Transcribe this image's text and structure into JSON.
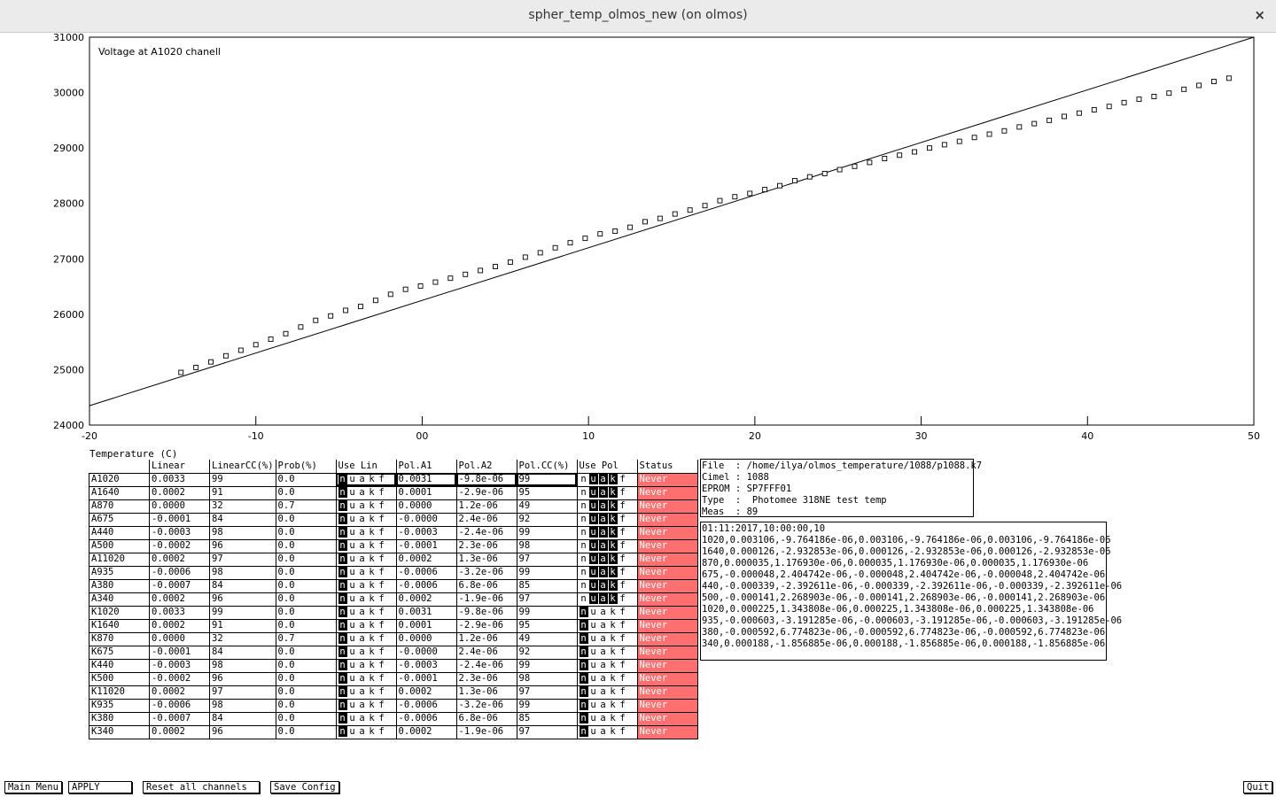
{
  "window": {
    "title": "spher_temp_olmos_new (on olmos)",
    "close_glyph": "×"
  },
  "chart_data": {
    "type": "scatter",
    "title": "Voltage at A1020 chanell",
    "xlabel": "Temperature (C)",
    "ylabel": "",
    "xlim": [
      -20,
      50
    ],
    "ylim": [
      24000,
      31000
    ],
    "x_ticks": [
      "-20",
      "-10",
      "00",
      "10",
      "20",
      "30",
      "40",
      "50"
    ],
    "y_ticks": [
      "24000",
      "25000",
      "26000",
      "27000",
      "28000",
      "29000",
      "30000",
      "31000"
    ],
    "fit_line": {
      "x": [
        -20,
        50
      ],
      "y": [
        24350,
        31000
      ]
    },
    "points": {
      "x": [
        -14.5,
        -13.6,
        -12.7,
        -11.8,
        -10.9,
        -10.0,
        -9.1,
        -8.2,
        -7.3,
        -6.4,
        -5.5,
        -4.6,
        -3.7,
        -2.8,
        -1.9,
        -1.0,
        -0.1,
        0.8,
        1.7,
        2.6,
        3.5,
        4.4,
        5.3,
        6.2,
        7.1,
        8.0,
        8.9,
        9.8,
        10.7,
        11.6,
        12.5,
        13.4,
        14.3,
        15.2,
        16.1,
        17.0,
        17.9,
        18.8,
        19.7,
        20.6,
        21.5,
        22.4,
        23.3,
        24.2,
        25.1,
        26.0,
        26.9,
        27.8,
        28.7,
        29.6,
        30.5,
        31.4,
        32.3,
        33.2,
        34.1,
        35.0,
        35.9,
        36.8,
        37.7,
        38.6,
        39.5,
        40.4,
        41.3,
        42.2,
        43.1,
        44.0,
        44.9,
        45.8,
        46.7,
        47.6,
        48.5
      ],
      "y": [
        24950,
        25040,
        25140,
        25250,
        25350,
        25450,
        25550,
        25650,
        25770,
        25890,
        25970,
        26070,
        26140,
        26250,
        26360,
        26450,
        26510,
        26580,
        26650,
        26720,
        26790,
        26860,
        26940,
        27030,
        27110,
        27200,
        27290,
        27370,
        27450,
        27500,
        27570,
        27670,
        27730,
        27810,
        27880,
        27960,
        28050,
        28120,
        28180,
        28250,
        28320,
        28410,
        28480,
        28540,
        28610,
        28670,
        28740,
        28810,
        28870,
        28930,
        29000,
        29060,
        29120,
        29190,
        29250,
        29310,
        29380,
        29440,
        29500,
        29570,
        29630,
        29690,
        29750,
        29820,
        29880,
        29930,
        29990,
        30060,
        30130,
        30200,
        30260
      ]
    }
  },
  "table": {
    "headers": [
      "",
      "Linear",
      "LinearCC(%)",
      "Prob(%)",
      "Use Lin",
      "Pol.A1",
      "Pol.A2",
      "Pol.CC(%)",
      "Use Pol",
      "Status"
    ],
    "rows": [
      {
        "name": "A1020",
        "lin": "0.0033",
        "lcc": "99",
        "prob": "0.0",
        "a1": "0.0031",
        "a2": "-9.8e-06",
        "pcc": "99",
        "status": "Never",
        "uselin": "n",
        "usepol": "uak"
      },
      {
        "name": "A1640",
        "lin": "0.0002",
        "lcc": "91",
        "prob": "0.0",
        "a1": "0.0001",
        "a2": "-2.9e-06",
        "pcc": "95",
        "status": "Never",
        "uselin": "n",
        "usepol": "uak"
      },
      {
        "name": "A870",
        "lin": "0.0000",
        "lcc": "32",
        "prob": "0.7",
        "a1": "0.0000",
        "a2": "1.2e-06",
        "pcc": "49",
        "status": "Never",
        "uselin": "n",
        "usepol": "uak"
      },
      {
        "name": "A675",
        "lin": "-0.0001",
        "lcc": "84",
        "prob": "0.0",
        "a1": "-0.0000",
        "a2": "2.4e-06",
        "pcc": "92",
        "status": "Never",
        "uselin": "n",
        "usepol": "uak"
      },
      {
        "name": "A440",
        "lin": "-0.0003",
        "lcc": "98",
        "prob": "0.0",
        "a1": "-0.0003",
        "a2": "-2.4e-06",
        "pcc": "99",
        "status": "Never",
        "uselin": "n",
        "usepol": "uak"
      },
      {
        "name": "A500",
        "lin": "-0.0002",
        "lcc": "96",
        "prob": "0.0",
        "a1": "-0.0001",
        "a2": "2.3e-06",
        "pcc": "98",
        "status": "Never",
        "uselin": "n",
        "usepol": "uak"
      },
      {
        "name": "A11020",
        "lin": "0.0002",
        "lcc": "97",
        "prob": "0.0",
        "a1": "0.0002",
        "a2": "1.3e-06",
        "pcc": "97",
        "status": "Never",
        "uselin": "n",
        "usepol": "uak"
      },
      {
        "name": "A935",
        "lin": "-0.0006",
        "lcc": "98",
        "prob": "0.0",
        "a1": "-0.0006",
        "a2": "-3.2e-06",
        "pcc": "99",
        "status": "Never",
        "uselin": "n",
        "usepol": "uak"
      },
      {
        "name": "A380",
        "lin": "-0.0007",
        "lcc": "84",
        "prob": "0.0",
        "a1": "-0.0006",
        "a2": "6.8e-06",
        "pcc": "85",
        "status": "Never",
        "uselin": "n",
        "usepol": "uak"
      },
      {
        "name": "A340",
        "lin": "0.0002",
        "lcc": "96",
        "prob": "0.0",
        "a1": "0.0002",
        "a2": "-1.9e-06",
        "pcc": "97",
        "status": "Never",
        "uselin": "n",
        "usepol": "uak"
      },
      {
        "name": "K1020",
        "lin": "0.0033",
        "lcc": "99",
        "prob": "0.0",
        "a1": "0.0031",
        "a2": "-9.8e-06",
        "pcc": "99",
        "status": "Never",
        "uselin": "n",
        "usepol": "n"
      },
      {
        "name": "K1640",
        "lin": "0.0002",
        "lcc": "91",
        "prob": "0.0",
        "a1": "0.0001",
        "a2": "-2.9e-06",
        "pcc": "95",
        "status": "Never",
        "uselin": "n",
        "usepol": "n"
      },
      {
        "name": "K870",
        "lin": "0.0000",
        "lcc": "32",
        "prob": "0.7",
        "a1": "0.0000",
        "a2": "1.2e-06",
        "pcc": "49",
        "status": "Never",
        "uselin": "n",
        "usepol": "n"
      },
      {
        "name": "K675",
        "lin": "-0.0001",
        "lcc": "84",
        "prob": "0.0",
        "a1": "-0.0000",
        "a2": "2.4e-06",
        "pcc": "92",
        "status": "Never",
        "uselin": "n",
        "usepol": "n"
      },
      {
        "name": "K440",
        "lin": "-0.0003",
        "lcc": "98",
        "prob": "0.0",
        "a1": "-0.0003",
        "a2": "-2.4e-06",
        "pcc": "99",
        "status": "Never",
        "uselin": "n",
        "usepol": "n"
      },
      {
        "name": "K500",
        "lin": "-0.0002",
        "lcc": "96",
        "prob": "0.0",
        "a1": "-0.0001",
        "a2": "2.3e-06",
        "pcc": "98",
        "status": "Never",
        "uselin": "n",
        "usepol": "n"
      },
      {
        "name": "K11020",
        "lin": "0.0002",
        "lcc": "97",
        "prob": "0.0",
        "a1": "0.0002",
        "a2": "1.3e-06",
        "pcc": "97",
        "status": "Never",
        "uselin": "n",
        "usepol": "n"
      },
      {
        "name": "K935",
        "lin": "-0.0006",
        "lcc": "98",
        "prob": "0.0",
        "a1": "-0.0006",
        "a2": "-3.2e-06",
        "pcc": "99",
        "status": "Never",
        "uselin": "n",
        "usepol": "n"
      },
      {
        "name": "K380",
        "lin": "-0.0007",
        "lcc": "84",
        "prob": "0.0",
        "a1": "-0.0006",
        "a2": "6.8e-06",
        "pcc": "85",
        "status": "Never",
        "uselin": "n",
        "usepol": "n"
      },
      {
        "name": "K340",
        "lin": "0.0002",
        "lcc": "96",
        "prob": "0.0",
        "a1": "0.0002",
        "a2": "-1.9e-06",
        "pcc": "97",
        "status": "Never",
        "uselin": "n",
        "usepol": "n"
      }
    ],
    "flag_letters": [
      "n",
      "u",
      "a",
      "k",
      "f"
    ]
  },
  "info": {
    "lines": [
      "File  : /home/ilya/olmos_temperature/1088/p1088.k7",
      "Cimel : 1088",
      "EPROM : SP7FFF01",
      "Type  :  Photomee 318NE test temp",
      "Meas  : 89"
    ]
  },
  "coefficients": {
    "lines": [
      "01:11:2017,10:00:00,10",
      "1020,0.003106,-9.764186e-06,0.003106,-9.764186e-06,0.003106,-9.764186e-06",
      "1640,0.000126,-2.932853e-06,0.000126,-2.932853e-06,0.000126,-2.932853e-06",
      "870,0.000035,1.176930e-06,0.000035,1.176930e-06,0.000035,1.176930e-06",
      "675,-0.000048,2.404742e-06,-0.000048,2.404742e-06,-0.000048,2.404742e-06",
      "440,-0.000339,-2.392611e-06,-0.000339,-2.392611e-06,-0.000339,-2.392611e-06",
      "500,-0.000141,2.268903e-06,-0.000141,2.268903e-06,-0.000141,2.268903e-06",
      "1020,0.000225,1.343808e-06,0.000225,1.343808e-06,0.000225,1.343808e-06",
      "935,-0.000603,-3.191285e-06,-0.000603,-3.191285e-06,-0.000603,-3.191285e-06",
      "380,-0.000592,6.774823e-06,-0.000592,6.774823e-06,-0.000592,6.774823e-06",
      "340,0.000188,-1.856885e-06,0.000188,-1.856885e-06,0.000188,-1.856885e-06"
    ]
  },
  "buttons": {
    "main_menu": "Main Menu",
    "apply": "APPLY",
    "reset": "Reset all channels",
    "save": "Save Config",
    "quit": "Quit"
  },
  "colors": {
    "status_bg": "#fe7070",
    "titlebar_bg": "#ebebeb"
  }
}
